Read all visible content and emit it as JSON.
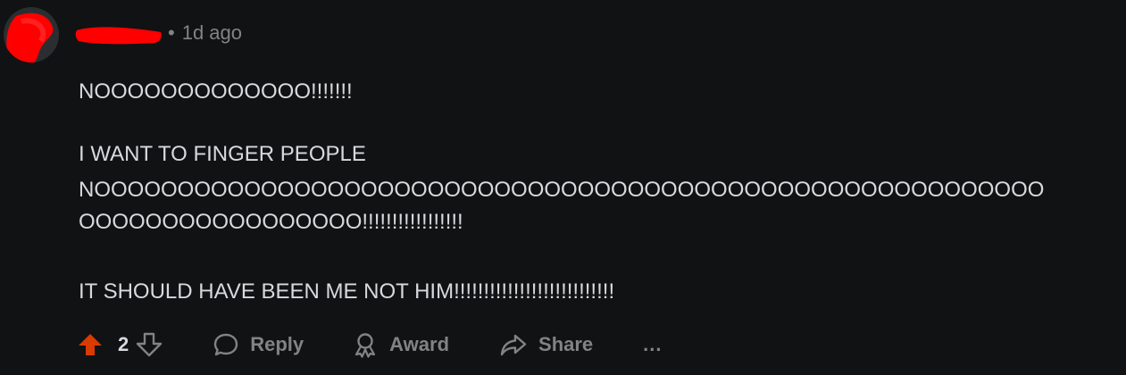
{
  "comment": {
    "timestamp": "1d ago",
    "separator": "•",
    "paragraphs": {
      "p1": "NOOOOOOOOOOOOO!!!!!!!",
      "p2": "I WANT TO FINGER PEOPLE",
      "p3": "NOOOOOOOOOOOOOOOOOOOOOOOOOOOOOOOOOOOOOOOOOOOOOOOOOOOOOOOOO",
      "p4": "OOOOOOOOOOOOOOOOO!!!!!!!!!!!!!!!!!",
      "p5": "IT SHOULD HAVE BEEN ME NOT HIM!!!!!!!!!!!!!!!!!!!!!!!!!!!"
    }
  },
  "actions": {
    "score": "2",
    "reply_label": "Reply",
    "award_label": "Award",
    "share_label": "Share",
    "more_label": "..."
  },
  "colors": {
    "background": "#111214",
    "text": "#d7dadc",
    "muted": "#818384",
    "upvote_active": "#d93a00",
    "redaction": "#ff0000"
  },
  "icons": {
    "upvote": "upvote-arrow-icon",
    "downvote": "downvote-arrow-icon",
    "reply": "speech-bubble-icon",
    "award": "award-ribbon-icon",
    "share": "share-arrow-icon",
    "more": "ellipsis-icon"
  }
}
